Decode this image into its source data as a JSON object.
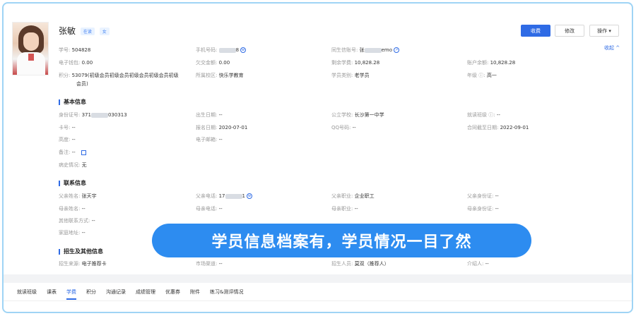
{
  "student": {
    "name": "张敏",
    "tag_status": "在读",
    "tag_gender": "女",
    "student_no_label": "学号:",
    "student_no": "504828",
    "phone_label": "手机号码:",
    "phone_suffix": "8",
    "wechat_label": "同生信账号:",
    "wechat_prefix": "张",
    "wechat_suffix": "emo",
    "wallet_label": "电子钱包:",
    "wallet": "0.00",
    "arrears_label": "欠交金额:",
    "arrears": "0.00",
    "remaining_label": "剩余学费:",
    "remaining": "10,828.28",
    "balance_label": "账户余额:",
    "balance": "10,828.28",
    "points_label": "积分:",
    "points_line1": "53079(初级会员初级会员初级会员初级会员初级",
    "points_line2": "会员)",
    "campus_label": "所属校区:",
    "campus": "快乐学教育",
    "category_label": "学员类别:",
    "category": "老学员",
    "grade_label": "年级 ⓘ:",
    "grade": "高一"
  },
  "actions": {
    "charge": "收费",
    "edit": "修改",
    "ops": "操作 ▾",
    "collapse": "收起 ^"
  },
  "basic": {
    "title": "基本信息",
    "id_label": "身份证号:",
    "id_prefix": "371",
    "id_suffix": "030313",
    "birth_label": "出生日期:",
    "birth": "--",
    "school_label": "公立学校:",
    "school": "长沙第一中学",
    "class_label": "就读班级 ⓘ:",
    "class": "--",
    "card_label": "卡号:",
    "card": "--",
    "reg_label": "报名日期:",
    "reg": "2020-07-01",
    "qq_label": "QQ号码:",
    "qq": "--",
    "contract_label": "合同截至日期:",
    "contract": "2022-09-01",
    "height_label": "高度:",
    "height": "--",
    "email_label": "电子邮箱:",
    "email": "--",
    "remark_label": "备注:",
    "remark": "--",
    "history_label": "病史情况:",
    "history": "无"
  },
  "contact": {
    "title": "联系信息",
    "father_name_label": "父亲姓名:",
    "father_name": "张天宇",
    "father_phone_label": "父亲电话:",
    "father_phone_prefix": "17",
    "father_phone_suffix": "1",
    "father_job_label": "父亲职业:",
    "father_job": "企业职工",
    "father_id_label": "父亲身份证:",
    "father_id": "--",
    "mother_name_label": "母亲姓名:",
    "mother_name": "--",
    "mother_phone_label": "母亲电话:",
    "mother_phone": "--",
    "mother_job_label": "母亲职业:",
    "mother_job": "--",
    "mother_id_label": "母亲身份证:",
    "mother_id": "--",
    "other_label": "其他联系方式:",
    "other": "--",
    "address_label": "家庭地址:",
    "address": "--"
  },
  "enroll": {
    "title": "招生及其他信息",
    "source_label": "招生来源:",
    "source": "电子推荐卡",
    "channel_label": "市场渠道:",
    "channel": "--",
    "staff_label": "招生人员:",
    "staff": "莫双（推荐人）",
    "referrer_label": "介绍人:",
    "referrer": "--"
  },
  "banner_text": "学员信息档案有，学员情况一目了然",
  "tabs": [
    "就读班级",
    "课表",
    "学费",
    "积分",
    "沟通记录",
    "成绩管理",
    "优惠券",
    "附件",
    "练习&测评情况"
  ],
  "colors": {
    "primary": "#2f6be5",
    "banner": "#2d8cf0"
  }
}
